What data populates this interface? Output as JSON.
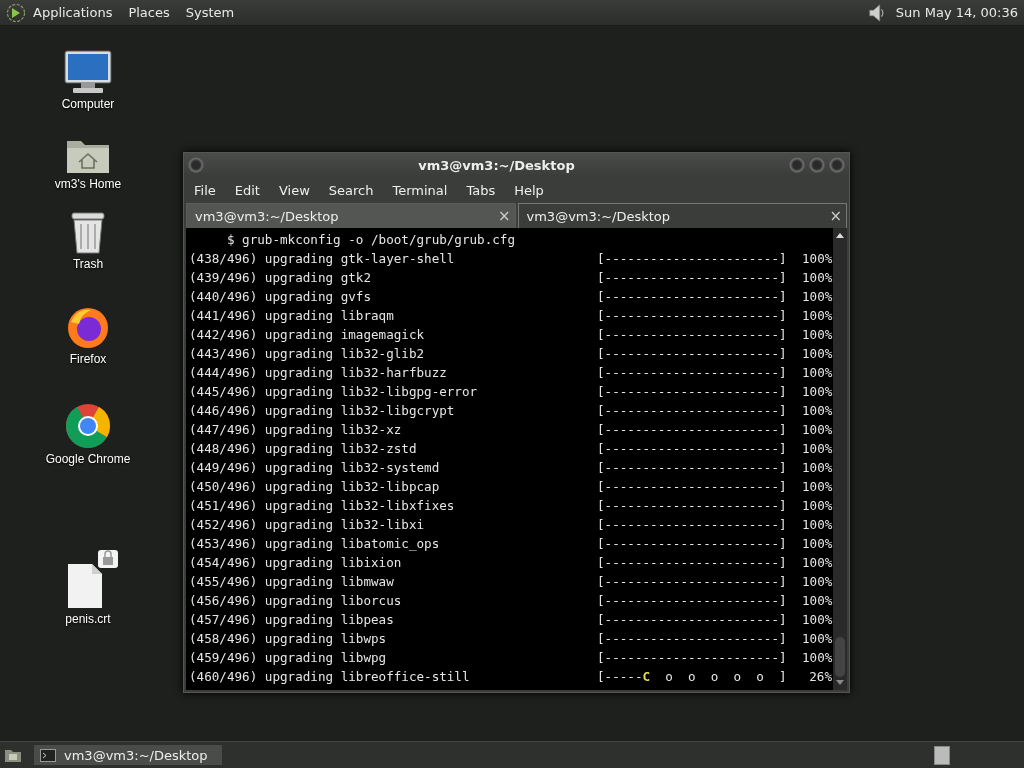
{
  "top_panel": {
    "menus": [
      "Applications",
      "Places",
      "System"
    ],
    "clock": "Sun May 14, 00:36"
  },
  "desktop_icons": [
    {
      "kind": "computer",
      "label": "Computer"
    },
    {
      "kind": "home",
      "label": "vm3's Home"
    },
    {
      "kind": "trash",
      "label": "Trash"
    },
    {
      "kind": "firefox",
      "label": "Firefox"
    },
    {
      "kind": "chrome",
      "label": "Google Chrome"
    },
    {
      "kind": "file",
      "label": "penis.crt"
    }
  ],
  "window": {
    "title": "vm3@vm3:~/Desktop",
    "menu": [
      "File",
      "Edit",
      "View",
      "Search",
      "Terminal",
      "Tabs",
      "Help"
    ],
    "tabs": [
      {
        "label": "vm3@vm3:~/Desktop",
        "close": "×",
        "selected": false
      },
      {
        "label": "vm3@vm3:~/Desktop",
        "close": "×",
        "selected": true
      }
    ],
    "terminal": {
      "command": "     $ grub-mkconfig -o /boot/grub/grub.cfg",
      "rows": [
        {
          "kind": "done",
          "line": "(438/496) upgrading gtk-layer-shell",
          "bar": "[-----------------------]",
          "percent": "100%"
        },
        {
          "kind": "done",
          "line": "(439/496) upgrading gtk2",
          "bar": "[-----------------------]",
          "percent": "100%"
        },
        {
          "kind": "done",
          "line": "(440/496) upgrading gvfs",
          "bar": "[-----------------------]",
          "percent": "100%"
        },
        {
          "kind": "done",
          "line": "(441/496) upgrading libraqm",
          "bar": "[-----------------------]",
          "percent": "100%"
        },
        {
          "kind": "done",
          "line": "(442/496) upgrading imagemagick",
          "bar": "[-----------------------]",
          "percent": "100%"
        },
        {
          "kind": "done",
          "line": "(443/496) upgrading lib32-glib2",
          "bar": "[-----------------------]",
          "percent": "100%"
        },
        {
          "kind": "done",
          "line": "(444/496) upgrading lib32-harfbuzz",
          "bar": "[-----------------------]",
          "percent": "100%"
        },
        {
          "kind": "done",
          "line": "(445/496) upgrading lib32-libgpg-error",
          "bar": "[-----------------------]",
          "percent": "100%"
        },
        {
          "kind": "done",
          "line": "(446/496) upgrading lib32-libgcrypt",
          "bar": "[-----------------------]",
          "percent": "100%"
        },
        {
          "kind": "done",
          "line": "(447/496) upgrading lib32-xz",
          "bar": "[-----------------------]",
          "percent": "100%"
        },
        {
          "kind": "done",
          "line": "(448/496) upgrading lib32-zstd",
          "bar": "[-----------------------]",
          "percent": "100%"
        },
        {
          "kind": "done",
          "line": "(449/496) upgrading lib32-systemd",
          "bar": "[-----------------------]",
          "percent": "100%"
        },
        {
          "kind": "done",
          "line": "(450/496) upgrading lib32-libpcap",
          "bar": "[-----------------------]",
          "percent": "100%"
        },
        {
          "kind": "done",
          "line": "(451/496) upgrading lib32-libxfixes",
          "bar": "[-----------------------]",
          "percent": "100%"
        },
        {
          "kind": "done",
          "line": "(452/496) upgrading lib32-libxi",
          "bar": "[-----------------------]",
          "percent": "100%"
        },
        {
          "kind": "done",
          "line": "(453/496) upgrading libatomic_ops",
          "bar": "[-----------------------]",
          "percent": "100%"
        },
        {
          "kind": "done",
          "line": "(454/496) upgrading libixion",
          "bar": "[-----------------------]",
          "percent": "100%"
        },
        {
          "kind": "done",
          "line": "(455/496) upgrading libmwaw",
          "bar": "[-----------------------]",
          "percent": "100%"
        },
        {
          "kind": "done",
          "line": "(456/496) upgrading liborcus",
          "bar": "[-----------------------]",
          "percent": "100%"
        },
        {
          "kind": "done",
          "line": "(457/496) upgrading libpeas",
          "bar": "[-----------------------]",
          "percent": "100%"
        },
        {
          "kind": "done",
          "line": "(458/496) upgrading libwps",
          "bar": "[-----------------------]",
          "percent": "100%"
        },
        {
          "kind": "done",
          "line": "(459/496) upgrading libwpg",
          "bar": "[-----------------------]",
          "percent": "100%"
        },
        {
          "kind": "progress",
          "line": "(460/496) upgrading libreoffice-still",
          "bar_done": "[-----",
          "bar_head": "C",
          "bar_rest": "  o  o  o  o  o  ]",
          "percent": "26%"
        }
      ]
    }
  },
  "taskbar": {
    "tasks": [
      {
        "label": "vm3@vm3:~/Desktop",
        "selected": true
      }
    ]
  }
}
